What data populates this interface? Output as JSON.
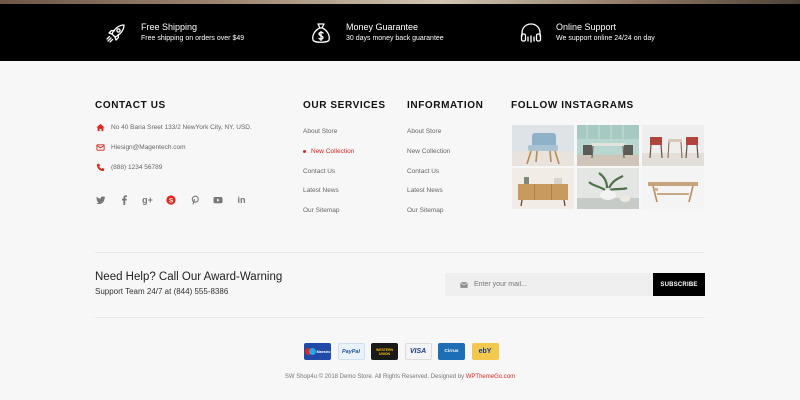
{
  "colors": {
    "accent": "#e2261d",
    "dark": "#000000",
    "background": "#f7f7f7"
  },
  "benefits": [
    {
      "icon": "rocket-icon",
      "title": "Free Shipping",
      "desc": "Free shipping on orders over $49"
    },
    {
      "icon": "money-bag-icon",
      "title": "Money Guarantee",
      "desc": "30 days money back guarantee"
    },
    {
      "icon": "headphones-icon",
      "title": "Online Support",
      "desc": "We support online 24/24 on day"
    }
  ],
  "contact": {
    "title": "CONTACT US",
    "address": "No 40 Baria Sreet 133/2 NewYork City, NY, USD.",
    "email": "Hiesign@Magentech.com",
    "phone": "(888) 1234 56789",
    "social": [
      "twitter-icon",
      "facebook-icon",
      "google-plus-icon",
      "skype-icon",
      "pinterest-icon",
      "youtube-icon",
      "linkedin-icon"
    ]
  },
  "services": {
    "title": "OUR SERVICES",
    "items": [
      "About Store",
      "New Collection",
      "Contact Us",
      "Latest News",
      "Our Sitemap"
    ],
    "active_index": 1
  },
  "information": {
    "title": "INFORMATION",
    "items": [
      "About Store",
      "New Collection",
      "Contact Us",
      "Latest News",
      "Our Sitemap"
    ]
  },
  "instagram": {
    "title": "FOLLOW INSTAGRAMS"
  },
  "help": {
    "title": "Need Help? Call Our Award-Warning",
    "subtitle": "Support Team 24/7 at (844) 555-8386"
  },
  "newsletter": {
    "placeholder": "Enter your mail...",
    "button": "SUBSCRIBE"
  },
  "payments": [
    "Maestro",
    "PayPal",
    "WESTERN UNION",
    "VISA",
    "Cirrus",
    "ebY"
  ],
  "footer": {
    "copyright_prefix": "SW Shop4u © 2018 Demo Store. All Rights Reserved. Designed by ",
    "designer": "WPThemeGo.com"
  }
}
